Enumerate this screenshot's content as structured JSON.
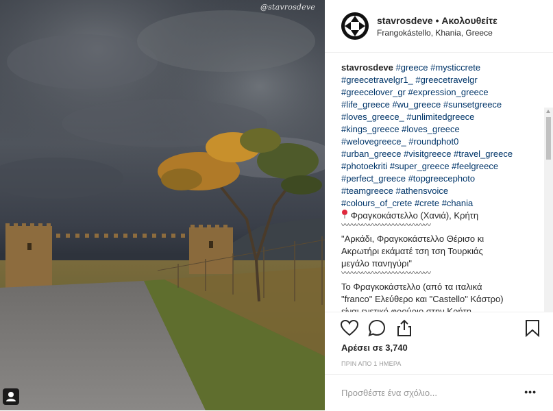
{
  "photo": {
    "watermark": "@stavrosdeve"
  },
  "header": {
    "username": "stavrosdeve",
    "separator": " • ",
    "follow_status": "Ακολουθείτε",
    "location": "Frangokástello, Khania, Greece"
  },
  "caption": {
    "username": "stavrosdeve",
    "hashtag_lines": [
      "#greece #mysticcrete",
      "#greecetravelgr1_ #greecetravelgr",
      "#greecelover_gr #expression_greece",
      "#life_greece #wu_greece #sunsetgreece",
      "#loves_greece_ #unlimitedgreece",
      "#kings_greece #loves_greece",
      "#welovegreece_ #roundphot0",
      "#urban_greece #visitgreece #travel_greece",
      "#photoekriti #super_greece #feelgreece",
      "#perfect_greece #topgreecephoto",
      "#teamgreece #athensvoice",
      "#colours_of_crete #crete #chania"
    ],
    "location_text": "Φραγκοκάστελλο (Χανιά), Κρήτη",
    "squiggle": "〰〰〰〰〰〰〰〰〰〰〰〰〰",
    "quote_lines": [
      "\"Αρκάδι, Φραγκοκάστελλο Θέρισο κι",
      "Ακρωτήρι εκάματέ τση τση Τουρκιάς",
      "μεγάλο πανηγύρι\""
    ],
    "body_lines": [
      "Το Φραγκοκάστελλο (από τα ιταλικά",
      "\"franco\" Ελεύθερο και \"Castello\" Κάστρο)",
      "είναι ενετικό φρούριο στην Κρήτη."
    ]
  },
  "actions": {
    "likes_text": "Αρέσει σε 3,740",
    "time_ago": "ΠΡΙΝ ΑΠΟ 1 ΗΜΕΡΑ"
  },
  "comment": {
    "placeholder": "Προσθέστε ένα σχόλιο...",
    "more": "•••"
  }
}
